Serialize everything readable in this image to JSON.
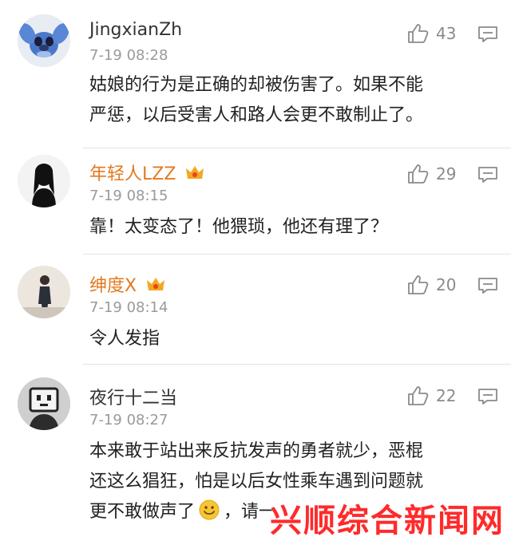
{
  "comments": [
    {
      "username": "JingxianZh",
      "vip": false,
      "time": "7-19 08:28",
      "likes": "43",
      "text_lines": [
        "姑娘的行为是正确的却被伤害了。如果不能",
        "严惩，以后受害人和路人会更不敢制止了。"
      ]
    },
    {
      "username": "年轻人LZZ",
      "vip": true,
      "time": "7-19 08:15",
      "likes": "29",
      "text_lines": [
        "靠！太变态了！他猥琐，他还有理了？"
      ]
    },
    {
      "username": "绅度X",
      "vip": true,
      "time": "7-19 08:14",
      "likes": "20",
      "text_lines": [
        "令人发指"
      ]
    },
    {
      "username": "夜行十二当",
      "vip": false,
      "time": "7-19 08:27",
      "likes": "22",
      "text_lines": [
        "本来敢于站出来反抗发声的勇者就少，恶棍",
        "还这么猖狂，怕是以后女性乘车遇到问题就",
        "更不敢做声了"
      ],
      "text_tail": "，请一"
    }
  ],
  "icons": {
    "like": "thumbs-up-icon",
    "reply": "comment-icon",
    "vip_badge": "crown-icon",
    "emoji": "smile-emoji-icon"
  },
  "colors": {
    "vip_name": "#e3791f",
    "watermark": "#ff2a2a"
  },
  "watermark": "兴顺综合新闻网"
}
